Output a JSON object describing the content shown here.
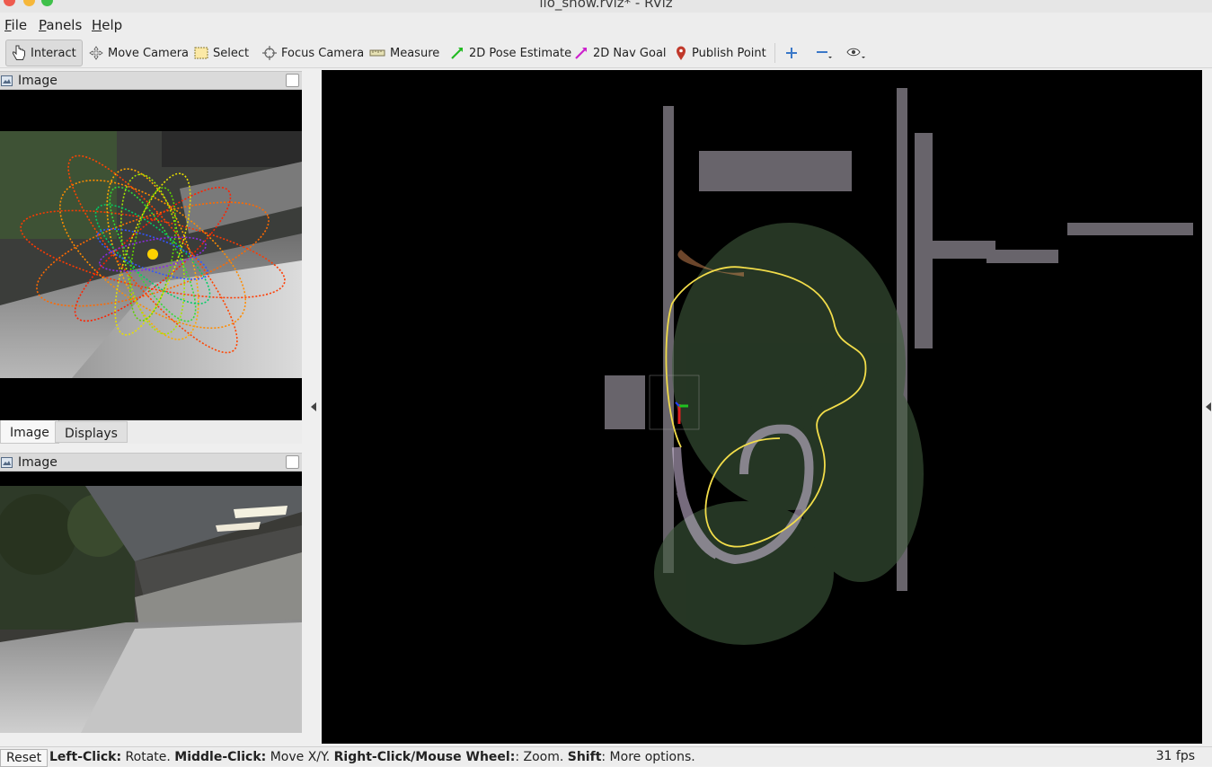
{
  "window": {
    "title": "lio_show.rviz* - RViz"
  },
  "menu": {
    "file": "File",
    "file_key": "F",
    "file_rest": "ile",
    "panels": "Panels",
    "panels_key": "P",
    "panels_rest": "anels",
    "help": "Help",
    "help_key": "H",
    "help_rest": "elp"
  },
  "toolbar": {
    "interact": "Interact",
    "move_camera": "Move Camera",
    "select": "Select",
    "focus_camera": "Focus Camera",
    "measure": "Measure",
    "pose_estimate": "2D Pose Estimate",
    "nav_goal": "2D Nav Goal",
    "publish_point": "Publish Point"
  },
  "panels": {
    "top": {
      "title": "Image"
    },
    "bottom": {
      "title": "Image"
    },
    "tabs": [
      "Image",
      "Displays"
    ]
  },
  "status": {
    "reset": "Reset",
    "hints": [
      {
        "key": "Left-Click:",
        "text": " Rotate. "
      },
      {
        "key": "Middle-Click:",
        "text": " Move X/Y. "
      },
      {
        "key": "Right-Click/Mouse Wheel:",
        "text": ": Zoom. "
      },
      {
        "key": "Shift",
        "text": ": More options."
      }
    ],
    "fps": "31 fps"
  },
  "colors": {
    "trajectory": "#f2dd4a",
    "pointcloud_tint": "#c8b4d8",
    "pose_arrow": "#33cc33",
    "nav_arrow": "#cc33cc",
    "publish_pin": "#c0392b"
  }
}
